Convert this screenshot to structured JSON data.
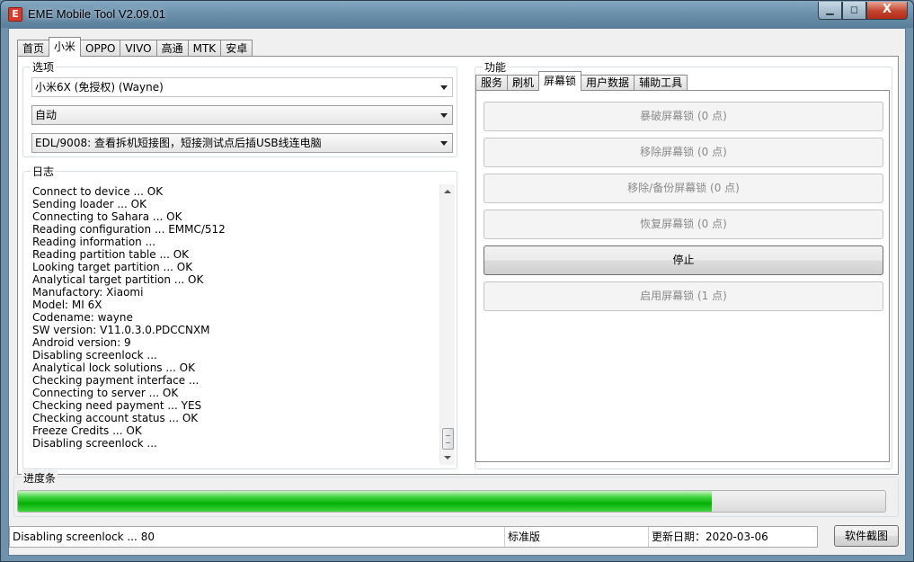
{
  "window": {
    "title": "EME Mobile Tool V2.09.01",
    "icon_letter": "E",
    "minimize": "▁",
    "maximize": "◻",
    "close": "X"
  },
  "top_tabs": [
    "首页",
    "小米",
    "OPPO",
    "VIVO",
    "高通",
    "MTK",
    "安卓"
  ],
  "active_top_tab": "小米",
  "options": {
    "label": "选项",
    "model_select": "小米6X (免授权) (Wayne)",
    "mode_select": "自动",
    "port_select": "EDL/9008: 查看拆机短接图，短接测试点后插USB线连电脑"
  },
  "log": {
    "label": "日志",
    "lines": [
      "Connect to device ... OK",
      "Sending loader ... OK",
      "Connecting to Sahara ... OK",
      "Reading configuration ... EMMC/512",
      "Reading information ...",
      "Reading partition table ... OK",
      "Looking target partition ... OK",
      "Analytical target partition ... OK",
      "Manufactory: Xiaomi",
      "Model: MI 6X",
      "Codename: wayne",
      "SW version: V11.0.3.0.PDCCNXM",
      "Android version: 9",
      "Disabling screenlock ...",
      "Analytical lock solutions ... OK",
      "Checking payment interface ...",
      "Connecting to server ... OK",
      "Checking need payment ... YES",
      "Checking account status ... OK",
      "Freeze Credits ... OK",
      "Disabling screenlock ..."
    ]
  },
  "functions": {
    "label": "功能",
    "tabs": [
      "服务",
      "刷机",
      "屏幕锁",
      "用户数据",
      "辅助工具"
    ],
    "active_tab": "屏幕锁",
    "buttons": [
      {
        "label": "暴破屏幕锁 (0 点)",
        "enabled": false
      },
      {
        "label": "移除屏幕锁 (0 点)",
        "enabled": false
      },
      {
        "label": "移除/备份屏幕锁 (0 点)",
        "enabled": false
      },
      {
        "label": "恢复屏幕锁 (0 点)",
        "enabled": false
      },
      {
        "label": "停止",
        "enabled": true
      },
      {
        "label": "启用屏幕锁 (1 点)",
        "enabled": false
      }
    ]
  },
  "progress": {
    "label": "进度条",
    "percent": 80
  },
  "status_bar": {
    "message": "Disabling screenlock ... 80",
    "edition": "标准版",
    "update_date": "更新日期：2020-03-06"
  },
  "screenshot_button": "软件截图"
}
